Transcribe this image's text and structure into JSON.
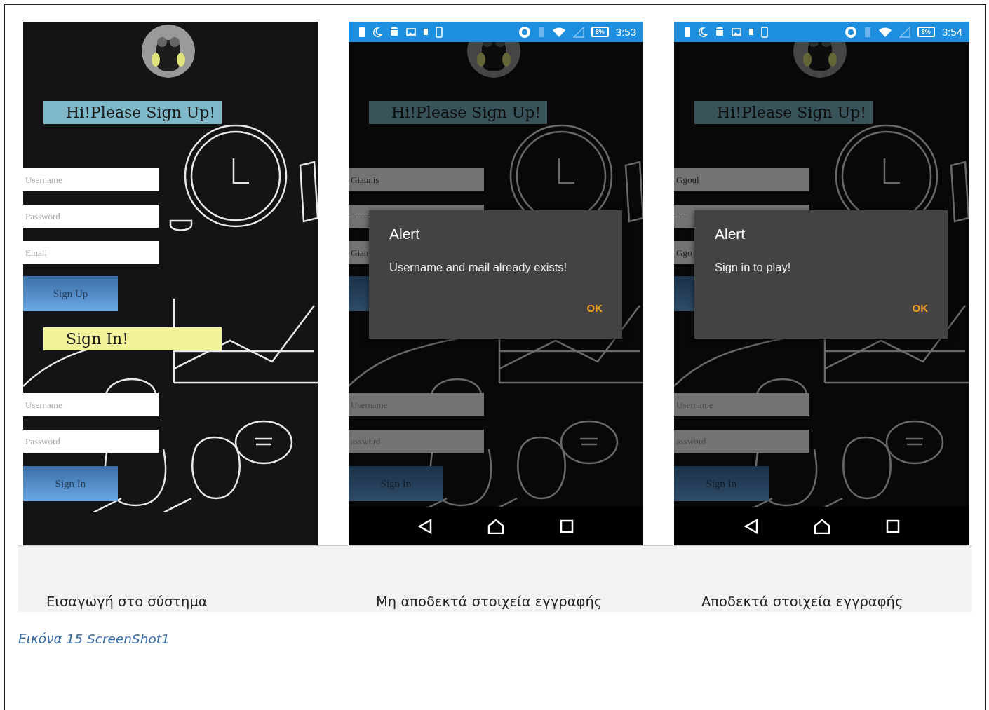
{
  "screens": [
    {
      "nav_bar": false,
      "signup": {
        "title": "Hi!Please Sign Up!",
        "fields": [
          {
            "placeholder": "Username"
          },
          {
            "placeholder": "Password"
          },
          {
            "placeholder": "Email"
          }
        ],
        "button": "Sign Up"
      },
      "signin": {
        "title": "Sign In!",
        "fields": [
          {
            "placeholder": "Username"
          },
          {
            "placeholder": "Password"
          }
        ],
        "button": "Sign In"
      },
      "caption": "Εισαγωγή στο σύστημα"
    },
    {
      "status_bar": {
        "battery": "8%",
        "time": "3:53"
      },
      "nav_bar": true,
      "signup": {
        "title": "Hi!Please Sign Up!",
        "fields": [
          {
            "value": "Giannis"
          },
          {
            "value": "------"
          },
          {
            "value": "Gian"
          }
        ]
      },
      "signin": {
        "fields": [
          {
            "placeholder": "Username"
          },
          {
            "placeholder": "assword"
          }
        ],
        "button": "Sign In"
      },
      "dialog": {
        "title": "Alert",
        "message": "Username and mail already exists!",
        "button": "OK"
      },
      "caption": "Μη αποδεκτά στοιχεία εγγραφής"
    },
    {
      "status_bar": {
        "battery": "8%",
        "time": "3:54"
      },
      "nav_bar": true,
      "signup": {
        "title": "Hi!Please Sign Up!",
        "fields": [
          {
            "value": "Ggoul"
          },
          {
            "value": "---"
          },
          {
            "value": "Ggo"
          }
        ]
      },
      "signin": {
        "fields": [
          {
            "placeholder": "Username"
          },
          {
            "placeholder": "assword"
          }
        ],
        "button": "Sign In"
      },
      "dialog": {
        "title": "Alert",
        "message": "Sign in to play!",
        "button": "OK"
      },
      "caption": "Αποδεκτά στοιχεία εγγραφής"
    }
  ],
  "figure_caption": "Εικόνα 15 ScreenShot1"
}
